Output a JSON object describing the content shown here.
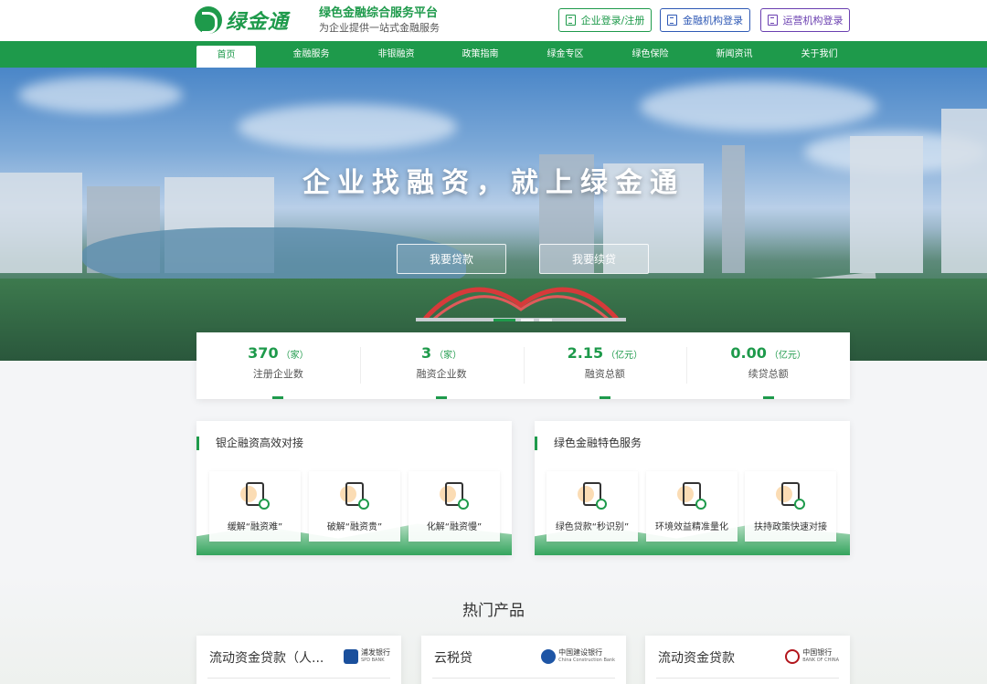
{
  "header": {
    "logo_text": "绿金通",
    "platform_title": "绿色金融综合服务平台",
    "platform_subtitle": "为企业提供一站式金融服务",
    "login_buttons": [
      {
        "label": "企业登录/注册",
        "icon": "building-icon",
        "color": "#1e9a4b"
      },
      {
        "label": "金融机构登录",
        "icon": "bank-icon",
        "color": "#2f59b5"
      },
      {
        "label": "运营机构登录",
        "icon": "office-icon",
        "color": "#6a3fb0"
      }
    ]
  },
  "nav": {
    "items": [
      "首页",
      "金融服务",
      "非银融资",
      "政策指南",
      "绿金专区",
      "绿色保险",
      "新闻资讯",
      "关于我们"
    ],
    "active": "首页"
  },
  "hero": {
    "title": "企业找融资，就上绿金通",
    "buttons": [
      "我要贷款",
      "我要续贷"
    ],
    "slide_count": 3,
    "active_slide": 1
  },
  "stats": [
    {
      "value": "370",
      "unit": "（家）",
      "label": "注册企业数"
    },
    {
      "value": "3",
      "unit": "（家）",
      "label": "融资企业数"
    },
    {
      "value": "2.15",
      "unit": "（亿元）",
      "label": "融资总额"
    },
    {
      "value": "0.00",
      "unit": "（亿元）",
      "label": "续贷总额"
    }
  ],
  "panels": [
    {
      "title": "银企融资高效对接",
      "cards": [
        {
          "label": "缓解“融资难”",
          "icon": "house-document-icon"
        },
        {
          "label": "破解“融资贵”",
          "icon": "star-house-check-icon"
        },
        {
          "label": "化解“融资慢”",
          "icon": "yen-hand-icon"
        }
      ]
    },
    {
      "title": "绿色金融特色服务",
      "cards": [
        {
          "label": "绿色贷款“秒识别”",
          "icon": "monitor-document-icon"
        },
        {
          "label": "环境效益精准量化",
          "icon": "document-chat-icon"
        },
        {
          "label": "扶持政策快速对接",
          "icon": "stamp-icon"
        }
      ]
    }
  ],
  "hot_products": {
    "title": "热门产品",
    "items": [
      {
        "name": "流动资金贷款（人...",
        "bank_name": "浦发银行",
        "bank_sub": "SPD BANK",
        "bank_color": "#1a4f9c"
      },
      {
        "name": "云税贷",
        "bank_name": "中国建设银行",
        "bank_sub": "China Construction Bank",
        "bank_color": "#1e55a5"
      },
      {
        "name": "流动资金贷款",
        "bank_name": "中国银行",
        "bank_sub": "BANK OF CHINA",
        "bank_color": "#b2151c"
      }
    ]
  },
  "colors": {
    "brand_green": "#1e9a4b",
    "blue": "#2f59b5",
    "purple": "#6a3fb0"
  }
}
